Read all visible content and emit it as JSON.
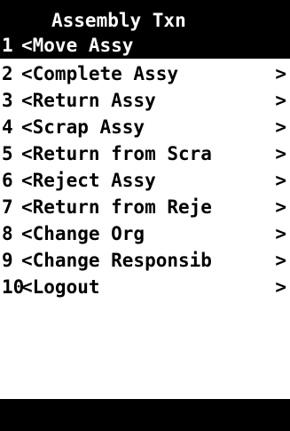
{
  "title": "Assembly Txn",
  "menu": {
    "items": [
      {
        "number": "1",
        "label": "<Move Assy",
        "arrow": ""
      },
      {
        "number": "2",
        "label": "<Complete Assy",
        "arrow": ">"
      },
      {
        "number": "3",
        "label": "<Return Assy",
        "arrow": ">"
      },
      {
        "number": "4",
        "label": "<Scrap Assy",
        "arrow": ">"
      },
      {
        "number": "5",
        "label": "<Return from Scra",
        "arrow": ">"
      },
      {
        "number": "6",
        "label": "<Reject Assy",
        "arrow": ">"
      },
      {
        "number": "7",
        "label": "<Return from Reje",
        "arrow": ">"
      },
      {
        "number": "8",
        "label": "<Change Org",
        "arrow": ">"
      },
      {
        "number": "9",
        "label": "<Change Responsib",
        "arrow": ">"
      },
      {
        "number": "10",
        "label": "<Logout",
        "arrow": ">"
      }
    ]
  },
  "colors": {
    "background": "#ffffff",
    "foreground": "#000000",
    "highlight_background": "#000000",
    "highlight_foreground": "#ffffff"
  }
}
